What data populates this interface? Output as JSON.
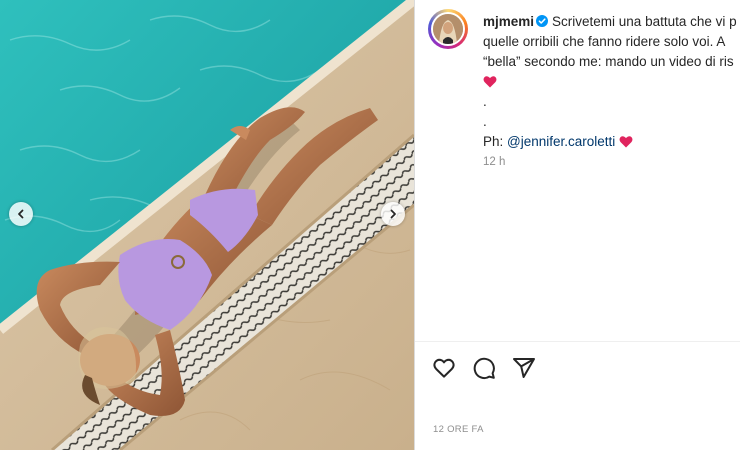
{
  "post": {
    "username": "mjmemi",
    "caption_line1": "Scrivetemi una battuta che vi p",
    "caption_line2": "quelle orribili che fanno ridere solo voi. A",
    "caption_line3": "“bella” secondo me: mando un video di ris",
    "dot1": ".",
    "dot2": ".",
    "credit_prefix": "Ph: ",
    "credit_mention": "@jennifer.caroletti",
    "comment_time": "12 h",
    "posted_ago": "12 ORE FA"
  },
  "icons": {
    "prev": "chevron-left-icon",
    "next": "chevron-right-icon",
    "like": "heart-icon",
    "comment": "comment-icon",
    "share": "share-icon",
    "verified": "verified-badge-icon"
  },
  "colors": {
    "accent_heart": "#ed4956",
    "verified": "#0095f6",
    "mention": "#00376b",
    "muted": "#8e8e8e"
  }
}
